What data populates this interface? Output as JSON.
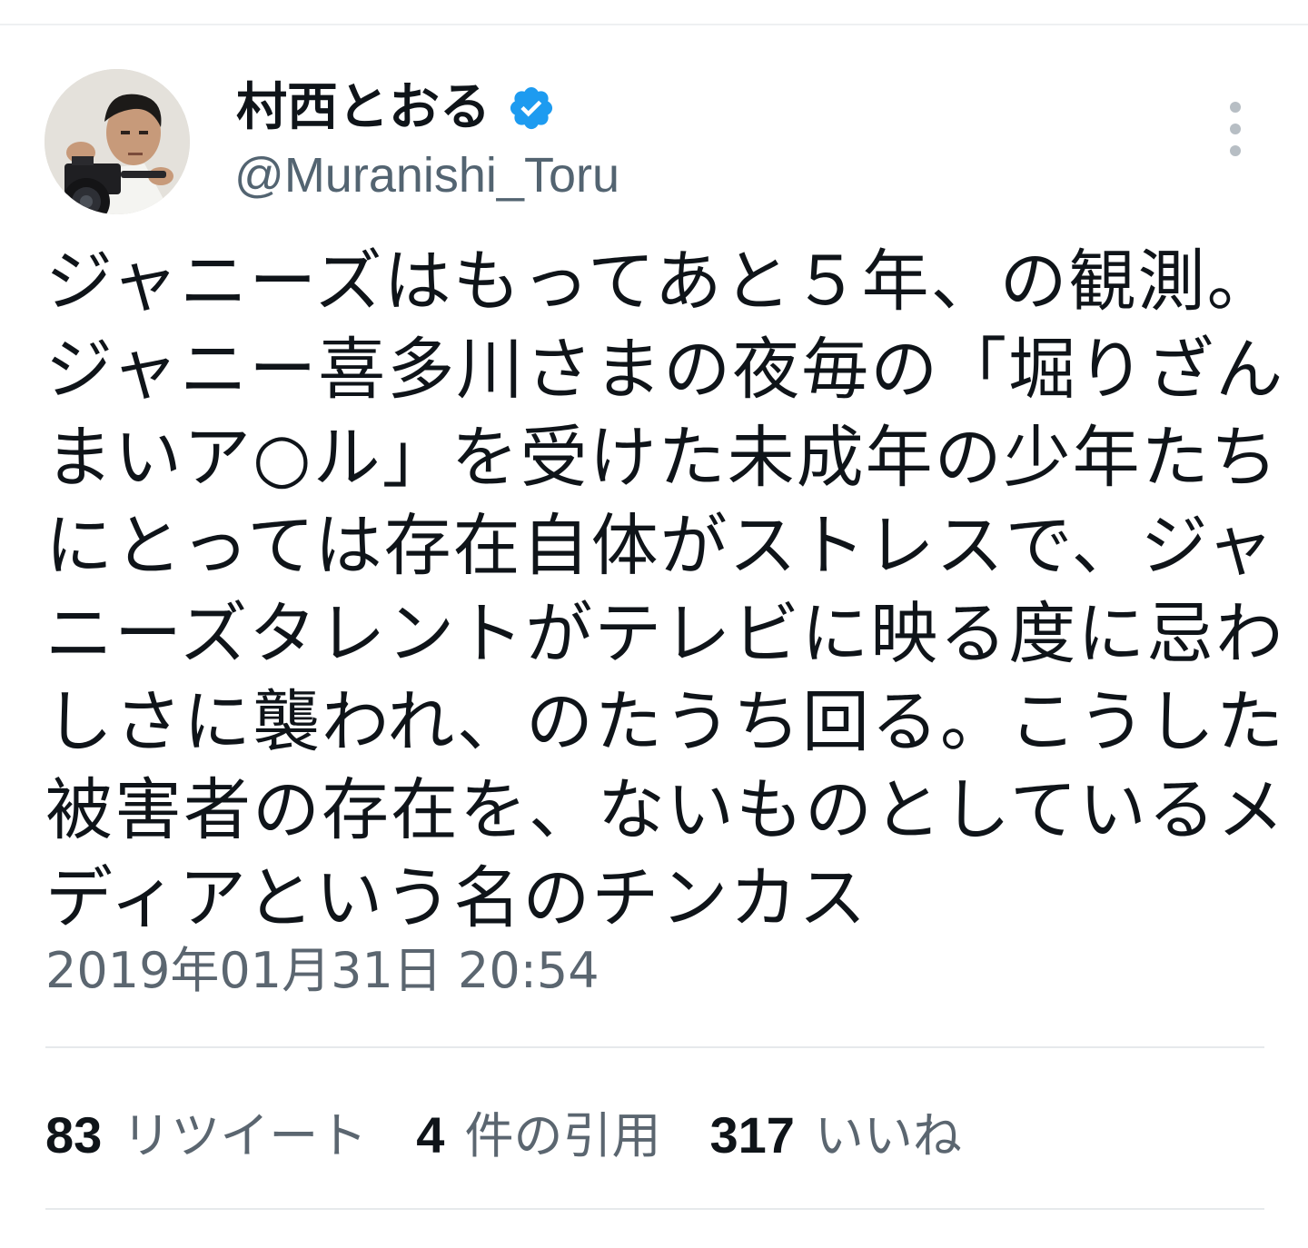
{
  "user": {
    "display_name": "村西とおる",
    "handle": "@Muranishi_Toru",
    "verified": true
  },
  "tweet": {
    "lines": [
      "ジャニーズはもってあと５年、の観測。",
      "ジャニー喜多川さまの夜毎の「堀りざん",
      "まいア○ル」を受けた未成年の少年たち",
      "にとっては存在自体がストレスで、ジャ",
      "ニーズタレントがテレビに映る度に忌わ",
      "しさに襲われ、のたうち回る。こうした",
      "被害者の存在を、ないものとしているメ",
      "ディアという名のチンカス"
    ],
    "timestamp": "2019年01月31日 20:54"
  },
  "stats": {
    "retweets": {
      "count": "83",
      "label": "リツイート"
    },
    "quotes": {
      "count": "4",
      "label": "件の引用"
    },
    "likes": {
      "count": "317",
      "label": "いいね"
    }
  },
  "icons": {
    "verified": "verified-badge-icon",
    "more": "more-vertical-icon"
  },
  "colors": {
    "verified_badge": "#1d9bf0",
    "secondary_text": "#536471",
    "divider": "#e6e9ec"
  }
}
